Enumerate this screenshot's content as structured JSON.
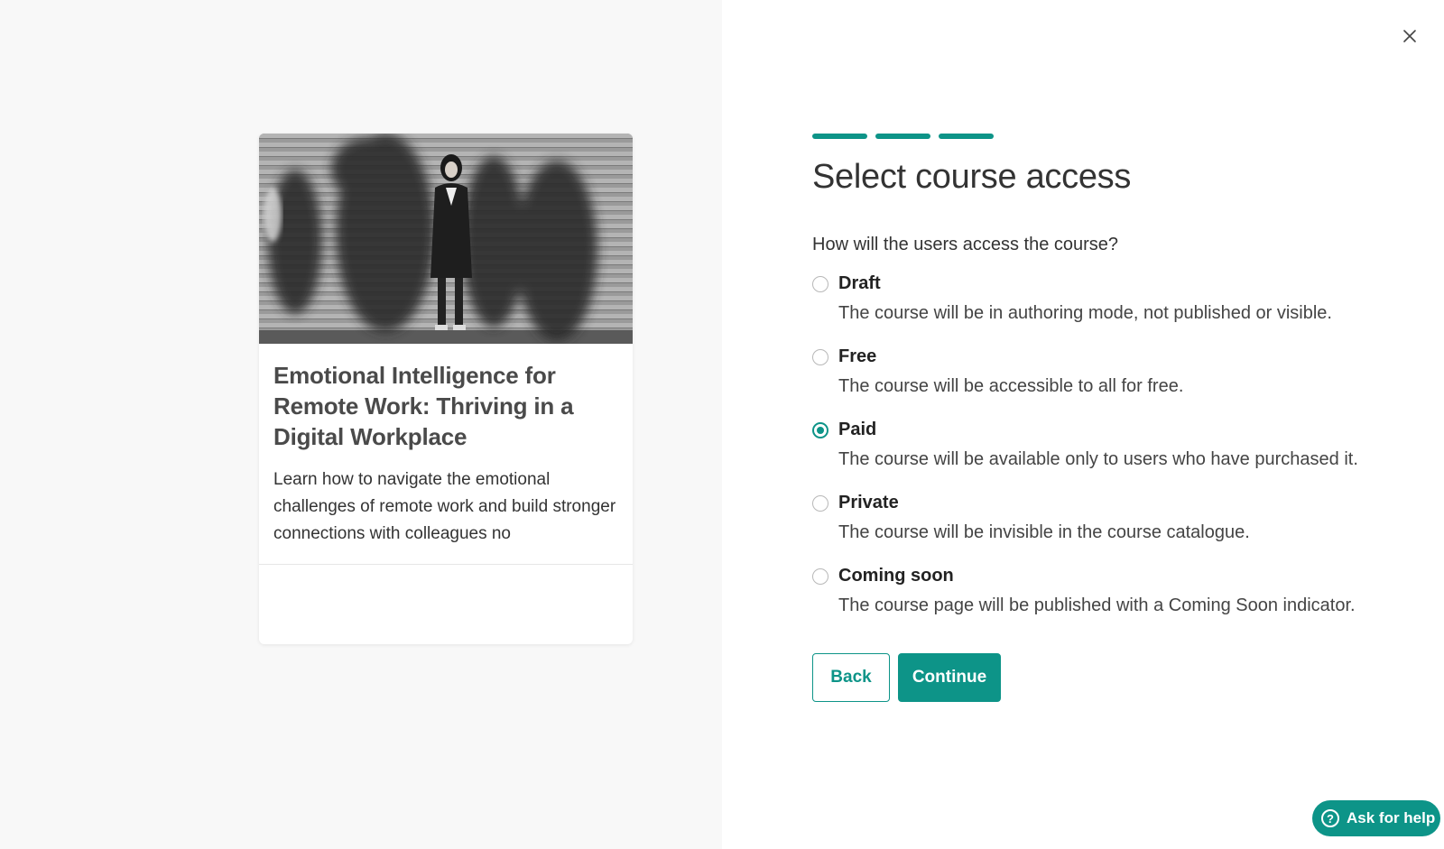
{
  "preview_card": {
    "image_icon": "photo-blurred-crowd",
    "title": "Emotional Intelligence for Remote Work: Thriving in a Digital Workplace",
    "description": "Learn how to navigate the emotional challenges of remote work and build stronger connections with colleagues no"
  },
  "wizard": {
    "close_icon": "close-icon",
    "steps_total": 3,
    "steps_completed": 3,
    "heading": "Select course access",
    "question": "How will the users access the course?",
    "options": [
      {
        "label": "Draft",
        "description": "The course will be in authoring mode, not published or visible.",
        "selected": false
      },
      {
        "label": "Free",
        "description": "The course will be accessible to all for free.",
        "selected": false
      },
      {
        "label": "Paid",
        "description": "The course will be available only to users who have purchased it.",
        "selected": true
      },
      {
        "label": "Private",
        "description": "The course will be invisible in the course catalogue.",
        "selected": false
      },
      {
        "label": "Coming soon",
        "description": "The course page will be published with a Coming Soon indicator.",
        "selected": false
      }
    ],
    "back_label": "Back",
    "continue_label": "Continue"
  },
  "help": {
    "icon": "question-circle-icon",
    "label": "Ask for help"
  },
  "colors": {
    "accent": "#0d9488",
    "left_background": "#f8f8f8"
  }
}
